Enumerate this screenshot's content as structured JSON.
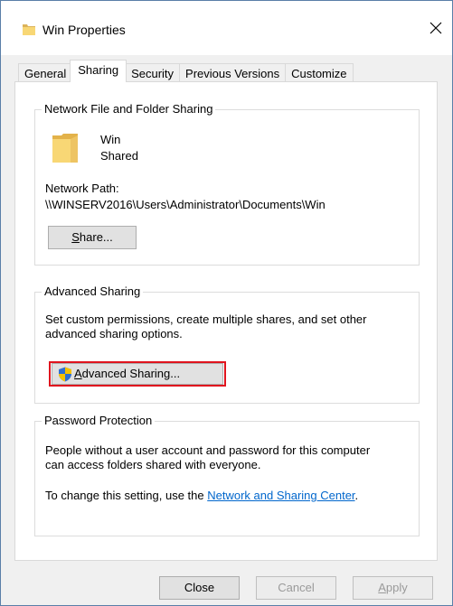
{
  "window": {
    "title": "Win Properties",
    "close_glyph": "✕"
  },
  "tabs": [
    {
      "label": "General",
      "active": false
    },
    {
      "label": "Sharing",
      "active": true
    },
    {
      "label": "Security",
      "active": false
    },
    {
      "label": "Previous Versions",
      "active": false
    },
    {
      "label": "Customize",
      "active": false
    }
  ],
  "network_sharing": {
    "group_title": "Network File and Folder Sharing",
    "folder_name": "Win",
    "share_status": "Shared",
    "path_label": "Network Path:",
    "path_value": "\\\\WINSERV2016\\Users\\Administrator\\Documents\\Win",
    "share_button": {
      "pre": "",
      "mnemonic": "S",
      "post": "hare..."
    }
  },
  "advanced_sharing": {
    "group_title": "Advanced Sharing",
    "description_line1": "Set custom permissions, create multiple shares, and set other",
    "description_line2": "advanced sharing options.",
    "button": {
      "pre": "",
      "mnemonic": "A",
      "post": "dvanced Sharing..."
    },
    "highlight_color": "#e0141e"
  },
  "password_protection": {
    "group_title": "Password Protection",
    "line1": "People without a user account and password for this computer",
    "line2": "can access folders shared with everyone.",
    "change_prefix": "To change this setting, use the ",
    "link_text": "Network and Sharing Center",
    "change_suffix": "."
  },
  "footer": {
    "close_label": "Close",
    "cancel_label": "Cancel",
    "apply": {
      "pre": "",
      "mnemonic": "A",
      "post": "pply"
    }
  },
  "colors": {
    "link": "#0066cc",
    "folder": "#f8d775",
    "shield_blue": "#2f6fd0",
    "shield_yellow": "#f5c200"
  },
  "icons": {
    "title": "folder-icon",
    "folder": "folder-icon",
    "shield": "uac-shield-icon",
    "close": "close-icon"
  }
}
